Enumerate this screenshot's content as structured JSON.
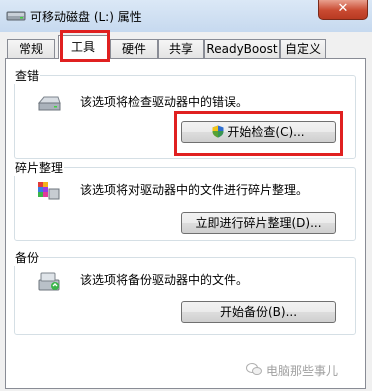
{
  "window": {
    "title": "可移动磁盘 (L:) 属性",
    "close_label": "✕"
  },
  "tabs": [
    {
      "label": "常规",
      "active": false
    },
    {
      "label": "工具",
      "active": true
    },
    {
      "label": "硬件",
      "active": false
    },
    {
      "label": "共享",
      "active": false
    },
    {
      "label": "ReadyBoost",
      "active": false
    },
    {
      "label": "自定义",
      "active": false
    }
  ],
  "sections": {
    "error_check": {
      "title": "查错",
      "description": "该选项将检查驱动器中的错误。",
      "button_label": "开始检查(C)...",
      "icon": "drive-icon"
    },
    "defrag": {
      "title": "碎片整理",
      "description": "该选项将对驱动器中的文件进行碎片整理。",
      "button_label": "立即进行碎片整理(D)...",
      "icon": "defrag-icon"
    },
    "backup": {
      "title": "备份",
      "description": "该选项将备份驱动器中的文件。",
      "button_label": "开始备份(B)...",
      "icon": "backup-icon"
    }
  },
  "watermark": "电脑那些事儿",
  "colors": {
    "highlight": "#e02020",
    "titlebar": "#c6d9ef",
    "close": "#c94a31"
  }
}
